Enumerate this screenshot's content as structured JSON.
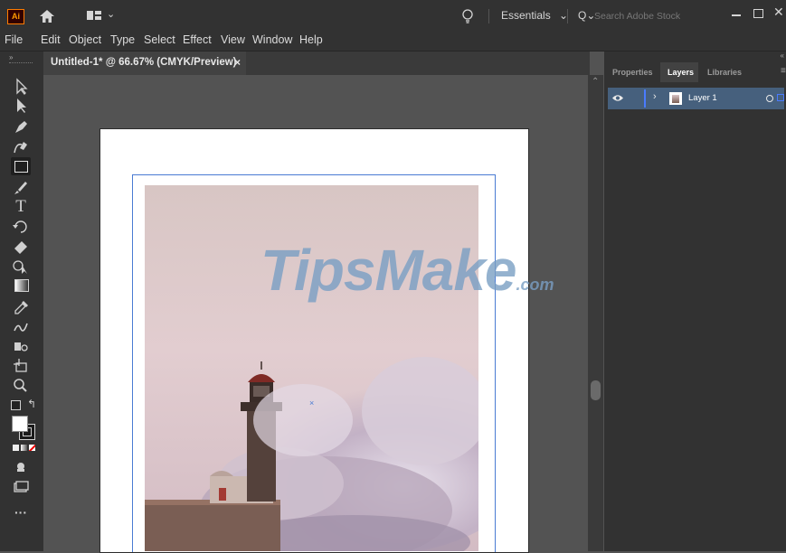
{
  "app": {
    "logo": "Ai",
    "workspace": "Essentials",
    "search_placeholder": "Search Adobe Stock"
  },
  "menu": [
    "File",
    "Edit",
    "Object",
    "Type",
    "Select",
    "Effect",
    "View",
    "Window",
    "Help"
  ],
  "document": {
    "tab_title": "Untitled-1* @ 66.67% (CMYK/Preview)",
    "close_glyph": "×"
  },
  "panel": {
    "tabs": [
      "Properties",
      "Layers",
      "Libraries"
    ],
    "active_tab": "Layers",
    "layers": [
      {
        "name": "Layer 1",
        "visible": true
      }
    ]
  },
  "watermark": {
    "text": "TipsMake",
    "suffix": ".com"
  },
  "colors": {
    "chrome": "#323232",
    "canvas": "#535353",
    "layer_highlight": "#46607d",
    "layer_color": "#4a7bff",
    "ai_brand": "#ff7c00"
  }
}
